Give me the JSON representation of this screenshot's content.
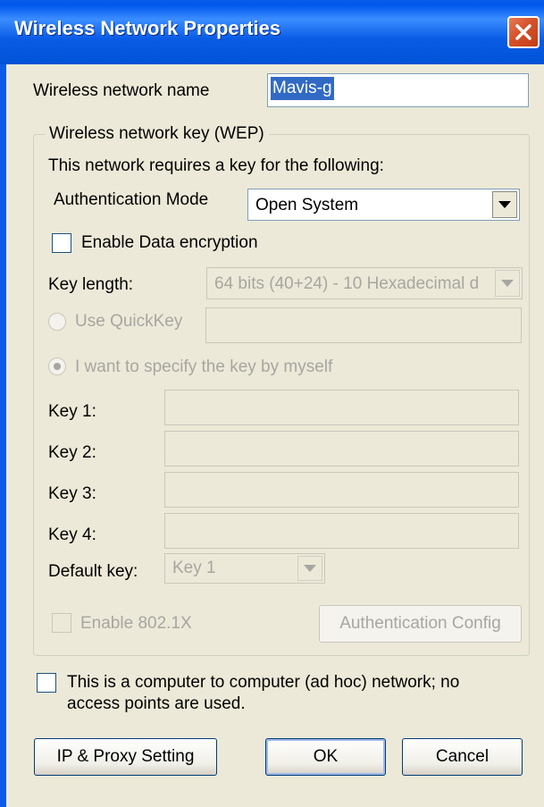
{
  "window": {
    "title": "Wireless Network Properties"
  },
  "network_name": {
    "label": "Wireless network name",
    "value": "Mavis-g"
  },
  "wep_group": {
    "title": "Wireless network key (WEP)",
    "requires_text": "This network requires a key for the following:",
    "auth_mode_label": "Authentication Mode",
    "auth_mode_value": "Open System",
    "enable_encryption_label": "Enable Data encryption",
    "enable_encryption_checked": false,
    "key_length_label": "Key length:",
    "key_length_value": "64 bits (40+24) - 10 Hexadecimal d",
    "use_quickkey_label": "Use QuickKey",
    "quickkey_value": "",
    "specify_key_label": "I want to specify the key by myself",
    "keys": [
      {
        "label": "Key 1:",
        "value": ""
      },
      {
        "label": "Key 2:",
        "value": ""
      },
      {
        "label": "Key 3:",
        "value": ""
      },
      {
        "label": "Key 4:",
        "value": ""
      }
    ],
    "default_key_label": "Default key:",
    "default_key_value": "Key 1",
    "enable_8021x_label": "Enable 802.1X",
    "auth_config_button": "Authentication Config"
  },
  "adhoc": {
    "label_line1": "This is a computer to computer (ad hoc) network; no",
    "label_line2": "access points are used.",
    "checked": false
  },
  "buttons": {
    "ip_proxy": "IP & Proxy Setting",
    "ok": "OK",
    "cancel": "Cancel"
  },
  "colors": {
    "titlebar": "#0a5ce6",
    "dialog_bg": "#ece9d8",
    "close_button": "#d5512a",
    "selection": "#316ac5",
    "disabled_text": "#a7a6a0"
  },
  "icons": {
    "close": "close-icon",
    "dropdown": "chevron-down-icon"
  }
}
